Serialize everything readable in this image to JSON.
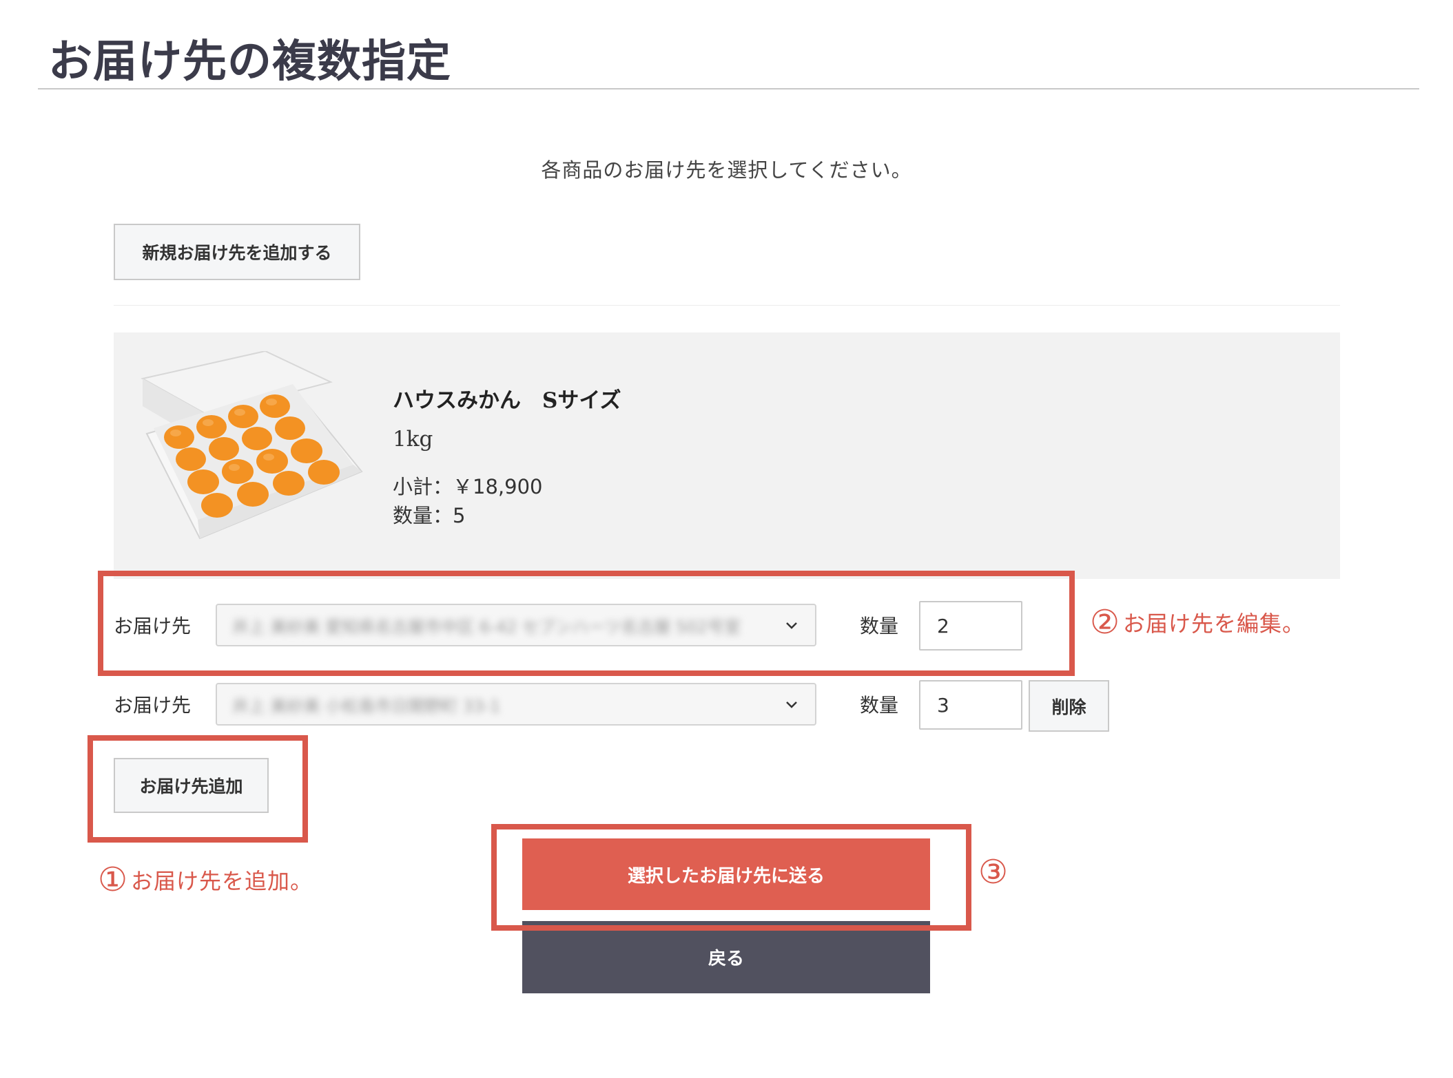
{
  "page": {
    "title": "お届け先の複数指定",
    "instructions": "各商品のお届け先を選択してください。"
  },
  "buttons": {
    "new_address": "新規お届け先を追加する",
    "add_destination": "お届け先追加",
    "delete": "削除",
    "submit": "選択したお届け先に送る",
    "back": "戻る"
  },
  "product": {
    "name": "ハウスみかん　Sサイズ",
    "variant": "1kg",
    "subtotal": "小計：￥18,900",
    "quantity": "数量：5",
    "image_icon": "mandarin-box-image"
  },
  "destinations": [
    {
      "label": "お届け先",
      "address": "井上 美紗美 愛知県名古屋市中区 6-42 セブンハーツ名古屋 502号室",
      "qty_label": "数量",
      "qty": "2"
    },
    {
      "label": "お届け先",
      "address": "井上 美紗美 小松島市日開野町 33-1",
      "qty_label": "数量",
      "qty": "3"
    }
  ],
  "annotations": {
    "one": {
      "num": "①",
      "text": "お届け先を追加。"
    },
    "two": {
      "num": "②",
      "text": "お届け先を編集。"
    },
    "three": {
      "num": "③"
    }
  },
  "colors": {
    "accent_red": "#d9584b",
    "primary_button": "#df5f51",
    "dark_button": "#51515f",
    "card_bg": "#f2f2f2"
  }
}
